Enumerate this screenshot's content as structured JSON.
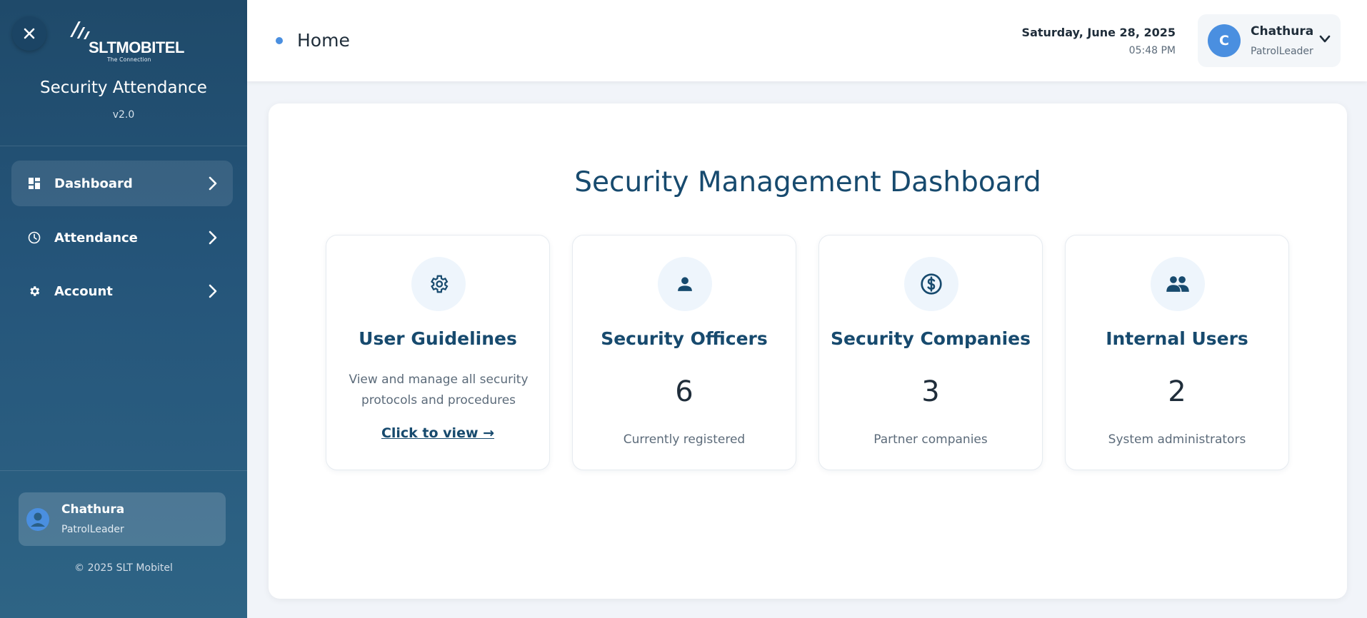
{
  "sidebar": {
    "logo": {
      "brand": "SLTMOBITEL",
      "tagline": "The Connection"
    },
    "app_title": "Security Attendance",
    "version": "v2.0",
    "nav": [
      {
        "label": "Dashboard",
        "icon": "dashboard-icon",
        "active": true
      },
      {
        "label": "Attendance",
        "icon": "clock-icon",
        "active": false
      },
      {
        "label": "Account",
        "icon": "gear-icon",
        "active": false
      }
    ],
    "user": {
      "name": "Chathura",
      "role": "PatrolLeader"
    },
    "copyright": "© 2025 SLT Mobitel"
  },
  "header": {
    "page_title": "Home",
    "date": "Saturday, June 28, 2025",
    "time": "05:48 PM",
    "profile": {
      "initial": "C",
      "name": "Chathura",
      "role": "PatrolLeader"
    }
  },
  "main": {
    "title": "Security Management Dashboard",
    "cards": [
      {
        "title": "User Guidelines",
        "icon": "settings-gear-icon",
        "description": "View and manage all security protocols and procedures",
        "link": "Click to view →"
      },
      {
        "title": "Security Officers",
        "icon": "person-icon",
        "value": "6",
        "subtitle": "Currently registered"
      },
      {
        "title": "Security Companies",
        "icon": "dollar-icon",
        "value": "3",
        "subtitle": "Partner companies"
      },
      {
        "title": "Internal Users",
        "icon": "group-icon",
        "value": "2",
        "subtitle": "System administrators"
      }
    ]
  },
  "colors": {
    "sidebar_top": "#1f4a6a",
    "sidebar_bottom": "#2e6485",
    "accent_blue": "#4a8fe0",
    "title_navy": "#174a6e"
  }
}
